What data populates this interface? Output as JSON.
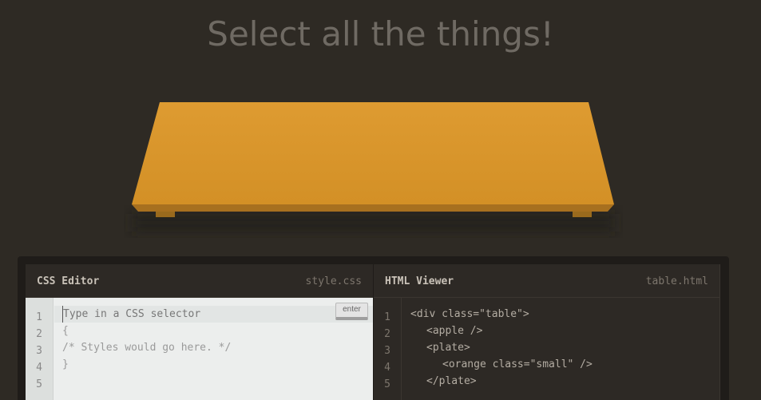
{
  "page": {
    "title": "Select all the things!"
  },
  "css_editor": {
    "title": "CSS Editor",
    "filename": "style.css",
    "input_placeholder": "Type in a CSS selector",
    "enter_label": "enter",
    "line_numbers": [
      "1",
      "2",
      "3",
      "4",
      "5"
    ],
    "lines": [
      "{",
      "/* Styles would go here. */",
      "}"
    ]
  },
  "html_viewer": {
    "title": "HTML Viewer",
    "filename": "table.html",
    "line_numbers": [
      "1",
      "2",
      "3",
      "4",
      "5"
    ],
    "lines": [
      "<div class=\"table\">",
      "<apple />",
      "<plate>",
      "<orange class=\"small\" />",
      "</plate>"
    ]
  },
  "colors": {
    "background": "#2e2a24",
    "table_top": "#d9962b",
    "table_edge": "#a7701f"
  }
}
